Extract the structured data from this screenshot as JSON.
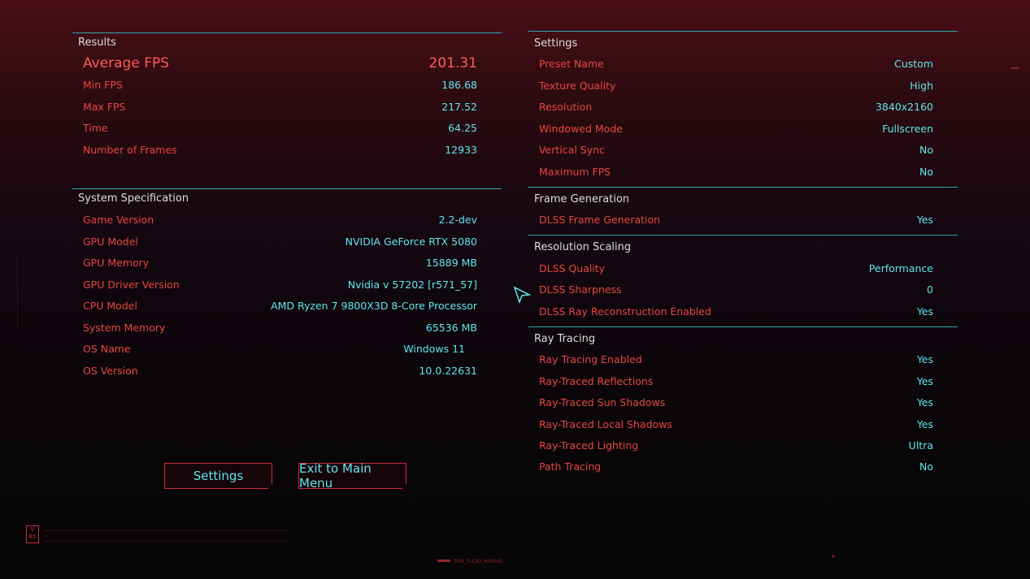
{
  "results": {
    "title": "Results",
    "rows": [
      {
        "label": "Average FPS",
        "value": "201.31"
      },
      {
        "label": "Min FPS",
        "value": "186.68"
      },
      {
        "label": "Max FPS",
        "value": "217.52"
      },
      {
        "label": "Time",
        "value": "64.25"
      },
      {
        "label": "Number of Frames",
        "value": "12933"
      }
    ]
  },
  "system": {
    "title": "System Specification",
    "rows": [
      {
        "label": "Game Version",
        "value": "2.2-dev"
      },
      {
        "label": "GPU Model",
        "value": "NVIDIA GeForce RTX 5080"
      },
      {
        "label": "GPU Memory",
        "value": "15889 MB"
      },
      {
        "label": "GPU Driver Version",
        "value": "Nvidia v 57202 [r571_57]"
      },
      {
        "label": "CPU Model",
        "value": "AMD Ryzen 7 9800X3D 8-Core Processor"
      },
      {
        "label": "System Memory",
        "value": "65536 MB"
      },
      {
        "label": "OS Name",
        "value": "Windows 11"
      },
      {
        "label": "OS Version",
        "value": "10.0.22631"
      }
    ]
  },
  "settings": {
    "title": "Settings",
    "rows": [
      {
        "label": "Preset Name",
        "value": "Custom"
      },
      {
        "label": "Texture Quality",
        "value": "High"
      },
      {
        "label": "Resolution",
        "value": "3840x2160"
      },
      {
        "label": "Windowed Mode",
        "value": "Fullscreen"
      },
      {
        "label": "Vertical Sync",
        "value": "No"
      },
      {
        "label": "Maximum FPS",
        "value": "No"
      }
    ]
  },
  "frame_generation": {
    "title": "Frame Generation",
    "rows": [
      {
        "label": "DLSS Frame Generation",
        "value": "Yes"
      }
    ]
  },
  "resolution_scaling": {
    "title": "Resolution Scaling",
    "rows": [
      {
        "label": "DLSS Quality",
        "value": "Performance"
      },
      {
        "label": "DLSS Sharpness",
        "value": "0"
      },
      {
        "label": "DLSS Ray Reconstruction Enabled",
        "value": "Yes"
      }
    ]
  },
  "ray_tracing": {
    "title": "Ray Tracing",
    "rows": [
      {
        "label": "Ray Tracing Enabled",
        "value": "Yes"
      },
      {
        "label": "Ray-Traced Reflections",
        "value": "Yes"
      },
      {
        "label": "Ray-Traced Sun Shadows",
        "value": "Yes"
      },
      {
        "label": "Ray-Traced Local Shadows",
        "value": "Yes"
      },
      {
        "label": "Ray-Traced Lighting",
        "value": "Ultra"
      },
      {
        "label": "Path Tracing",
        "value": "No"
      }
    ]
  },
  "buttons": {
    "settings": "Settings",
    "exit": "Exit to Main Menu"
  },
  "footer": {
    "logo": "V 85",
    "build_tag": "TRN_TLCAS_600095"
  },
  "colors": {
    "accent_cyan": "#5fe6ee",
    "label_red": "#e8473f",
    "divider": "#2fa7b3"
  }
}
